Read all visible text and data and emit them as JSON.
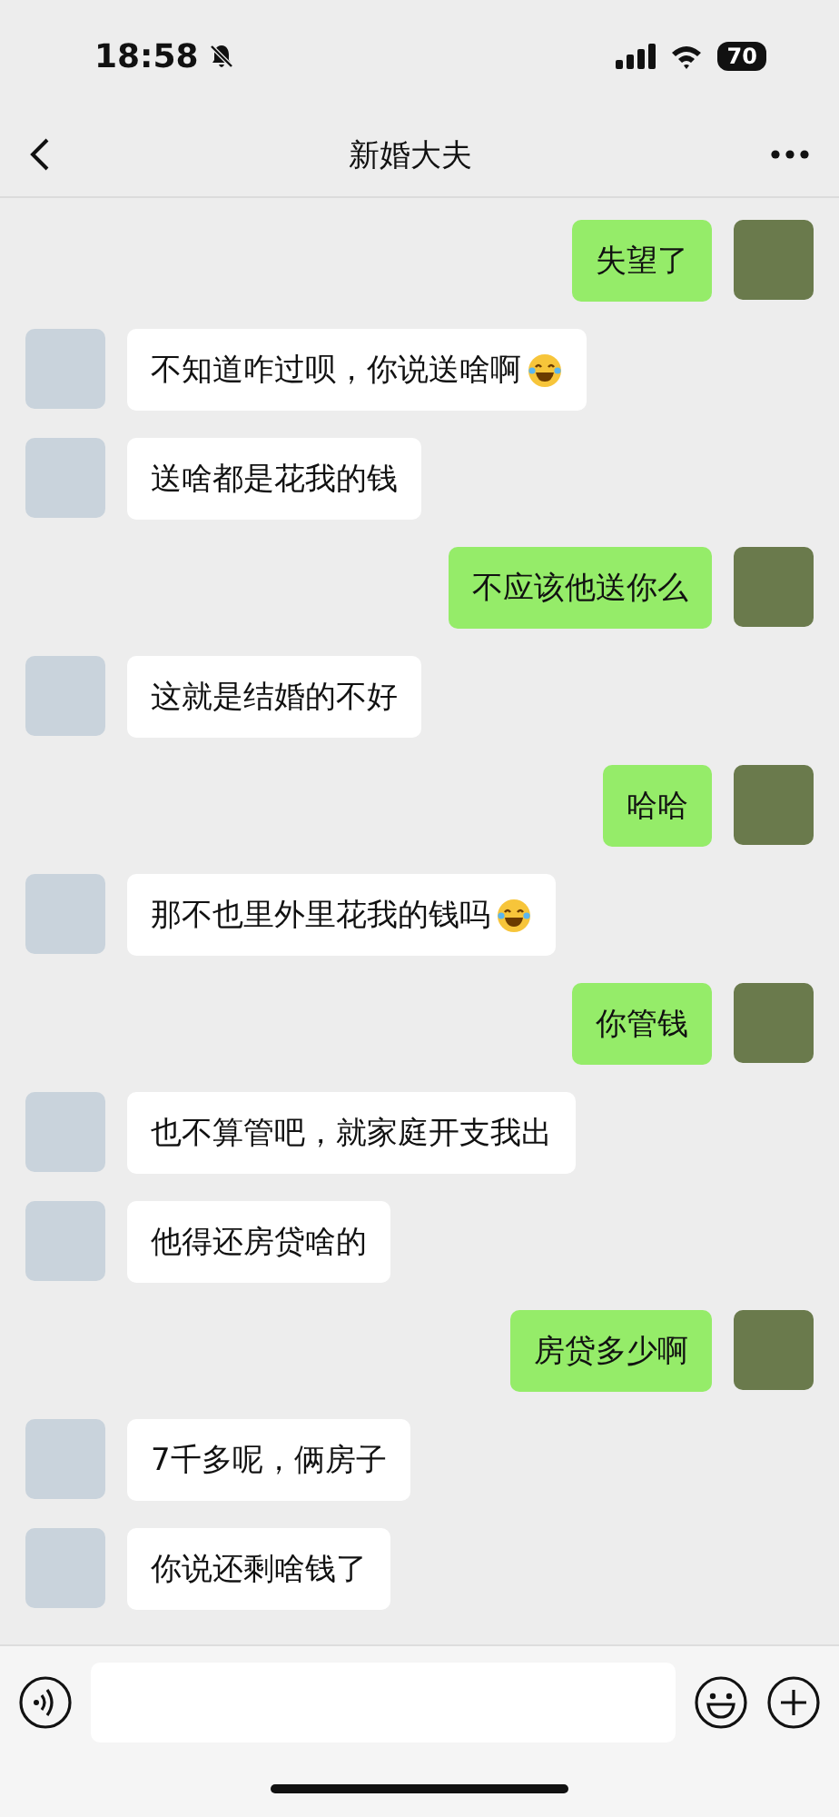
{
  "status_bar": {
    "time": "18:58",
    "muted": true,
    "battery": "70"
  },
  "header": {
    "title": "新婚大夫"
  },
  "messages": [
    {
      "sent": true,
      "text": "失望了",
      "trailing_emoji": false
    },
    {
      "sent": false,
      "text": "不知道咋过呗，你说送啥啊",
      "trailing_emoji": true
    },
    {
      "sent": false,
      "text": "送啥都是花我的钱",
      "trailing_emoji": false
    },
    {
      "sent": true,
      "text": "不应该他送你么",
      "trailing_emoji": false
    },
    {
      "sent": false,
      "text": "这就是结婚的不好",
      "trailing_emoji": false
    },
    {
      "sent": true,
      "text": "哈哈",
      "trailing_emoji": false
    },
    {
      "sent": false,
      "text": "那不也里外里花我的钱吗",
      "trailing_emoji": true
    },
    {
      "sent": true,
      "text": "你管钱",
      "trailing_emoji": false
    },
    {
      "sent": false,
      "text": "也不算管吧，就家庭开支我出",
      "trailing_emoji": false
    },
    {
      "sent": false,
      "text": "他得还房贷啥的",
      "trailing_emoji": false
    },
    {
      "sent": true,
      "text": "房贷多少啊",
      "trailing_emoji": false
    },
    {
      "sent": false,
      "text": "7千多呢，俩房子",
      "trailing_emoji": false
    },
    {
      "sent": false,
      "text": "你说还剩啥钱了",
      "trailing_emoji": false
    }
  ]
}
